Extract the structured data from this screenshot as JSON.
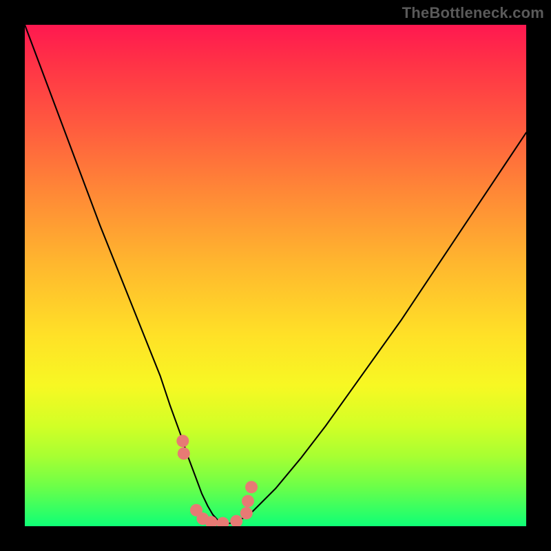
{
  "watermark": "TheBottleneck.com",
  "colors": {
    "frame": "#000000",
    "curve": "#000000",
    "marker_fill": "#e77a74",
    "gradient_top": "#ff1850",
    "gradient_bottom": "#0fff76"
  },
  "chart_data": {
    "type": "line",
    "title": "",
    "xlabel": "",
    "ylabel": "",
    "xlim": [
      0,
      100
    ],
    "ylim": [
      0,
      100
    ],
    "grid": false,
    "legend": false,
    "series": [
      {
        "name": "bottleneck-curve",
        "x": [
          0,
          3,
          6,
          9,
          12,
          15,
          18,
          21,
          24,
          27,
          29,
          31,
          32.5,
          34,
          35.3,
          36.5,
          37.5,
          38.5,
          40,
          42,
          45,
          50,
          55,
          60,
          65,
          70,
          75,
          80,
          85,
          90,
          95,
          100
        ],
        "y": [
          100,
          92,
          84,
          76,
          68,
          60,
          52.5,
          45,
          37.5,
          30,
          24,
          18.5,
          14,
          10,
          6.5,
          4,
          2.3,
          1.2,
          0.5,
          0.7,
          2.5,
          7.5,
          13.5,
          20,
          27,
          34,
          41,
          48.5,
          56,
          63.5,
          71,
          78.5
        ]
      }
    ],
    "markers": {
      "name": "highlighted-points",
      "x": [
        31.5,
        31.7,
        34.2,
        35.5,
        37.2,
        39.5,
        42.2,
        44.2,
        44.5,
        45.2
      ],
      "y": [
        17,
        14.5,
        3.2,
        1.5,
        0.8,
        0.6,
        1.0,
        2.6,
        5.0,
        7.8
      ]
    }
  }
}
